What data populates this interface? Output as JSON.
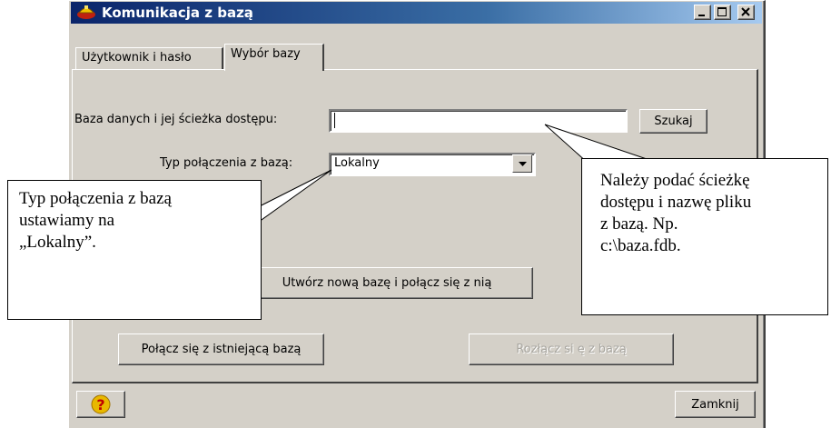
{
  "window": {
    "title": "Komunikacja z bazą",
    "icon": "app-database-icon",
    "controls": [
      "minimize-icon",
      "maximize-icon",
      "close-icon"
    ]
  },
  "tabs": [
    {
      "label": "Użytkownik i hasło",
      "active": false
    },
    {
      "label": "Wybór bazy",
      "active": true
    }
  ],
  "form": {
    "db_path_label": "Baza danych i jej ścieżka dostępu:",
    "db_path_value": "",
    "search_button": "Szukaj",
    "conn_type_label": "Typ połączenia z bazą:",
    "conn_type_value": "Lokalny"
  },
  "buttons": {
    "create_new": "Utwórz nową bazę i połącz się z nią",
    "connect_existing": "Połącz się z istniejącą bazą",
    "disconnect": "Rozłącz si ę z bazą",
    "close": "Zamknij",
    "help_icon": "question-mark-icon"
  },
  "callouts": {
    "left": [
      "Typ połączenia z bazą",
      "ustawiamy na",
      "„Lokalny”."
    ],
    "right": [
      "Należy podać ścieżkę",
      "dostępu  i nazwę pliku",
      "z bazą. Np.",
      "c:\\baza.fdb."
    ]
  },
  "colors": {
    "titlebar_start": "#0a246a",
    "titlebar_end": "#a6caf0",
    "face": "#d4d0c8",
    "help_icon": "#e8b800"
  }
}
